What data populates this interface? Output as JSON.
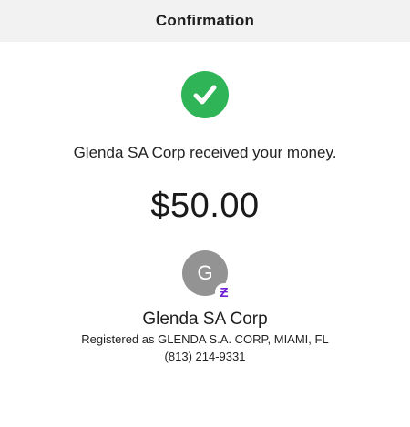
{
  "header": {
    "title": "Confirmation"
  },
  "status": {
    "icon": "checkmark-circle-icon",
    "color": "#2fb457",
    "message": "Glenda SA Corp received your money."
  },
  "payment": {
    "amount": "$50.00"
  },
  "recipient": {
    "avatar_initial": "G",
    "avatar_color": "#939393",
    "badge_icon": "cash-app-badge-icon",
    "badge_glyph": "Ƶ",
    "badge_color": "#6d1ed4",
    "name": "Glenda SA Corp",
    "registered": "Registered as GLENDA S.A. CORP, MIAMI, FL",
    "phone": "(813) 214-9331"
  }
}
